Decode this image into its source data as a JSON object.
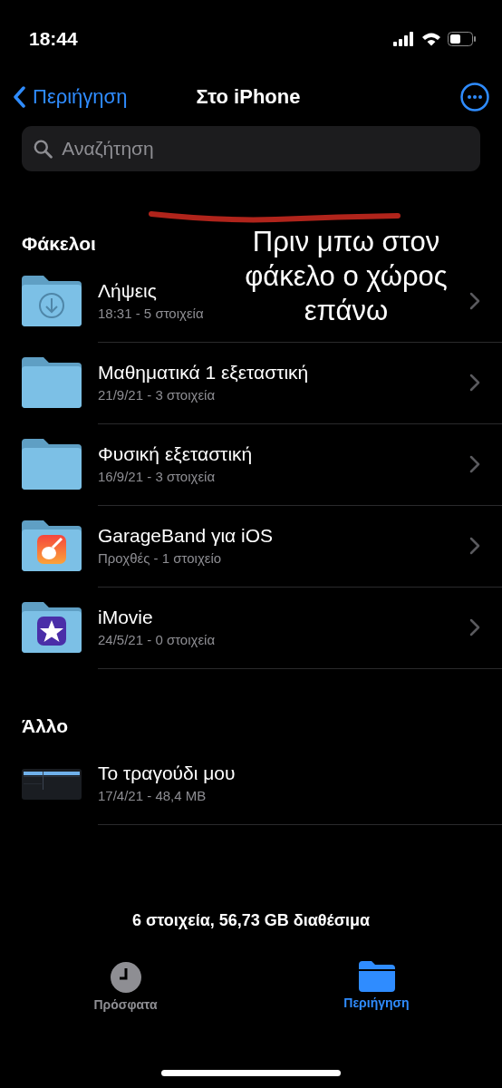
{
  "status_bar": {
    "time": "18:44"
  },
  "nav": {
    "back": "Περιήγηση",
    "title": "Στο iPhone"
  },
  "search": {
    "placeholder": "Αναζήτηση"
  },
  "sections": [
    {
      "title": "Φάκελοι",
      "items": [
        {
          "kind": "downloads",
          "name": "Λήψεις",
          "detail": "18:31 - 5 στοιχεία"
        },
        {
          "kind": "folder",
          "name": "Μαθηματικά 1 εξεταστική",
          "detail": "21/9/21 - 3 στοιχεία"
        },
        {
          "kind": "folder",
          "name": "Φυσική εξεταστική",
          "detail": "16/9/21 - 3 στοιχεία"
        },
        {
          "kind": "guitarapp",
          "name": "GarageBand για iOS",
          "detail": "Προχθές - 1 στοιχείο"
        },
        {
          "kind": "starapp",
          "name": "iMovie",
          "detail": "24/5/21 - 0 στοιχεία"
        }
      ]
    },
    {
      "title": "Άλλο",
      "items": [
        {
          "kind": "file",
          "name": "Το τραγούδι μου",
          "detail": "17/4/21 - 48,4 MB"
        }
      ]
    }
  ],
  "footer": "6 στοιχεία, 56,73 GB διαθέσιμα",
  "tabs": [
    {
      "label": "Πρόσφατα",
      "selected": false
    },
    {
      "label": "Περιήγηση",
      "selected": true
    }
  ],
  "annotation": {
    "text": "Πριν μπω στον φάκελο ο χώρος επάνω"
  }
}
